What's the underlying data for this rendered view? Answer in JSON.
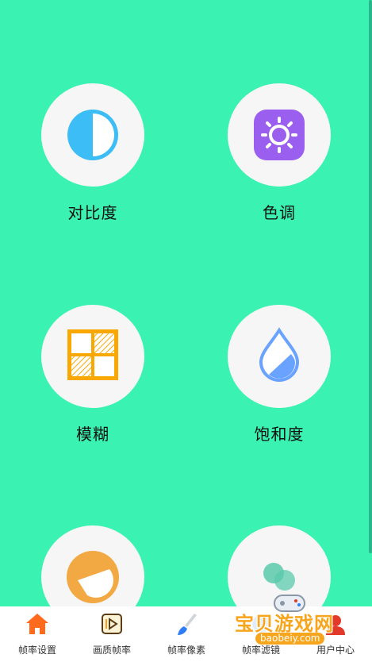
{
  "tiles": [
    {
      "label": "对比度",
      "icon": "contrast-icon"
    },
    {
      "label": "色调",
      "icon": "sun-icon"
    },
    {
      "label": "模糊",
      "icon": "grid-blur-icon"
    },
    {
      "label": "饱和度",
      "icon": "water-drop-icon"
    },
    {
      "label": "",
      "icon": "half-circle-icon"
    },
    {
      "label": "",
      "icon": "bubbles-icon"
    }
  ],
  "tabs": [
    {
      "label": "帧率设置",
      "icon": "home-icon"
    },
    {
      "label": "画质帧率",
      "icon": "video-icon"
    },
    {
      "label": "帧率像素",
      "icon": "brush-icon"
    },
    {
      "label": "帧率滤镜",
      "icon": "filter-icon"
    },
    {
      "label": "用户中心",
      "icon": "user-icon"
    }
  ],
  "watermark": {
    "title": "宝贝游戏网",
    "url": "baobeiy.com"
  },
  "colors": {
    "background": "#3af2b2",
    "circle": "#f6f6f6",
    "contrast": "#3dbdf5",
    "sun_tile": "#9b5ff0",
    "grid": "#f8a800",
    "drop": "#6aa2ff",
    "orange": "#f2a843",
    "bubbles": "#5bc9ac",
    "tab_active": "#ff6a1c"
  }
}
